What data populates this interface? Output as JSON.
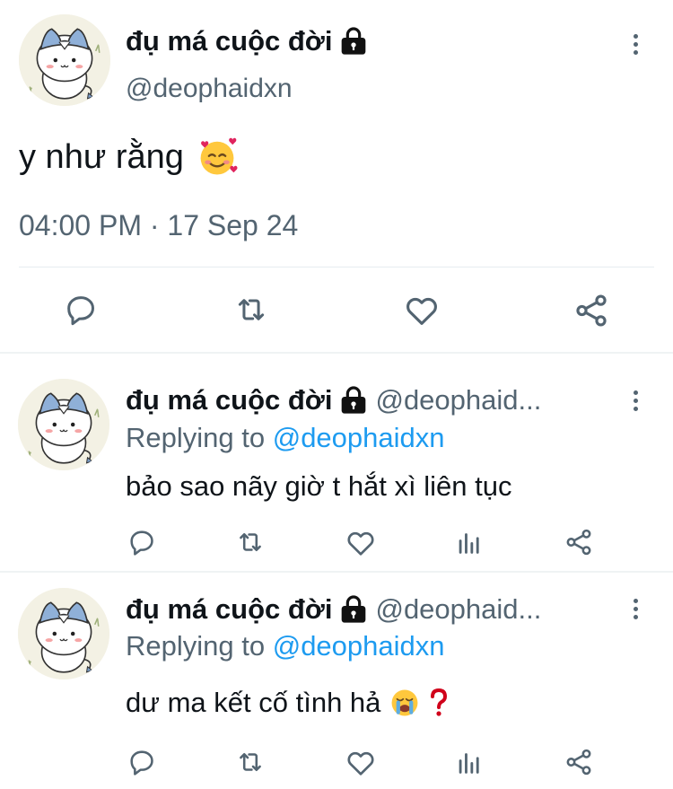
{
  "main_tweet": {
    "name": "đụ má cuộc đời",
    "handle": "@deophaidxn",
    "text": "y như rằng",
    "emoji": "smiling-face-with-hearts",
    "timestamp": "04:00 PM · 17 Sep 24",
    "actions": [
      "reply-icon",
      "retweet-icon",
      "like-icon",
      "share-icon"
    ]
  },
  "replies": [
    {
      "name": "đụ má cuộc đời",
      "handle": "@deophaid...",
      "replying_prefix": "Replying to ",
      "replying_to": "@deophaidxn",
      "text": "bảo sao nãy giờ t hắt xì liên tục",
      "actions": [
        "reply-icon",
        "retweet-icon",
        "like-icon",
        "views-icon",
        "share-icon"
      ]
    },
    {
      "name": "đụ má cuộc đời",
      "handle": "@deophaid...",
      "replying_prefix": "Replying to ",
      "replying_to": "@deophaidxn",
      "text": "dư ma kết cố tình hả",
      "emojis": [
        "loudly-crying-face",
        "red-question-mark"
      ],
      "actions": [
        "reply-icon",
        "retweet-icon",
        "like-icon",
        "views-icon",
        "share-icon"
      ]
    }
  ],
  "colors": {
    "text": "#0f1419",
    "secondary": "#536471",
    "link": "#1d9bf0",
    "divider": "#eff3f4"
  }
}
